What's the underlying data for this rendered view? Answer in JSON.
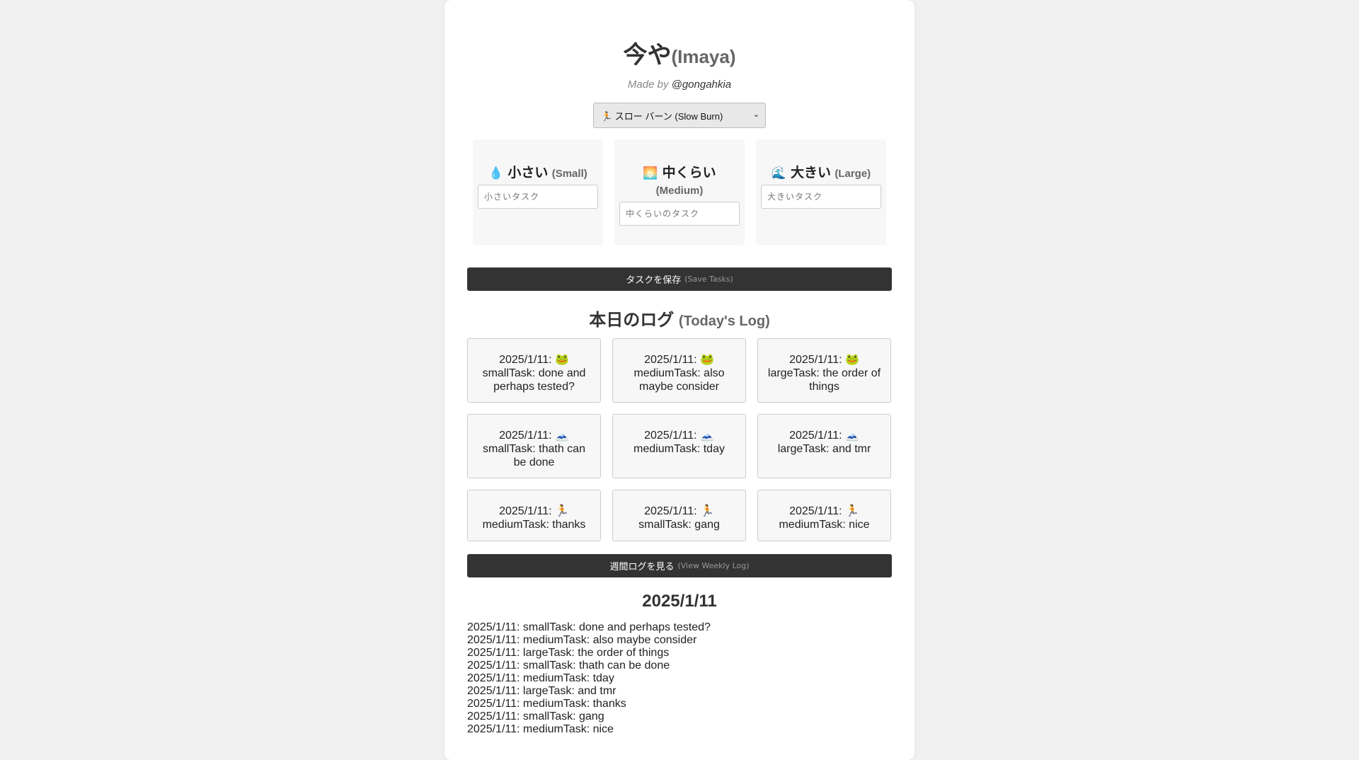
{
  "header": {
    "title_jp": "今や",
    "title_en": "(Imaya)",
    "made_by": "Made by ",
    "handle": "@gongahkia"
  },
  "mode": {
    "selected": "🏃 スロー バーン (Slow Burn)"
  },
  "sizes": [
    {
      "icon": "💧",
      "label": "小さい",
      "en": "(Small)",
      "placeholder": "小さいタスク"
    },
    {
      "icon": "🌅",
      "label": "中くらい",
      "en": "(Medium)",
      "placeholder": "中くらいのタスク"
    },
    {
      "icon": "🌊",
      "label": "大きい",
      "en": "(Large)",
      "placeholder": "大きいタスク"
    }
  ],
  "save_button": {
    "label": "タスクを保存",
    "en": "(Save Tasks)"
  },
  "today_log": {
    "title": "本日のログ",
    "title_en": "(Today's Log)",
    "entries": [
      {
        "date": "2025/1/11:",
        "icon": "🐸",
        "text": "smallTask: done and perhaps tested?"
      },
      {
        "date": "2025/1/11:",
        "icon": "🐸",
        "text": "mediumTask: also maybe consider"
      },
      {
        "date": "2025/1/11:",
        "icon": "🐸",
        "text": "largeTask: the order of things"
      },
      {
        "date": "2025/1/11:",
        "icon": "🗻",
        "text": "smallTask: thath can be done"
      },
      {
        "date": "2025/1/11:",
        "icon": "🗻",
        "text": "mediumTask: tday"
      },
      {
        "date": "2025/1/11:",
        "icon": "🗻",
        "text": "largeTask: and tmr"
      },
      {
        "date": "2025/1/11:",
        "icon": "🏃",
        "text": "mediumTask: thanks"
      },
      {
        "date": "2025/1/11:",
        "icon": "🏃",
        "text": "smallTask: gang"
      },
      {
        "date": "2025/1/11:",
        "icon": "🏃",
        "text": "mediumTask: nice"
      }
    ]
  },
  "weekly_button": {
    "label": "週間ログを見る",
    "en": "(View Weekly Log)"
  },
  "weekly": {
    "date_heading": "2025/1/11",
    "lines": [
      "2025/1/11: smallTask: done and perhaps tested?",
      "2025/1/11: mediumTask: also maybe consider",
      "2025/1/11: largeTask: the order of things",
      "2025/1/11: smallTask: thath can be done",
      "2025/1/11: mediumTask: tday",
      "2025/1/11: largeTask: and tmr",
      "2025/1/11: mediumTask: thanks",
      "2025/1/11: smallTask: gang",
      "2025/1/11: mediumTask: nice"
    ]
  }
}
